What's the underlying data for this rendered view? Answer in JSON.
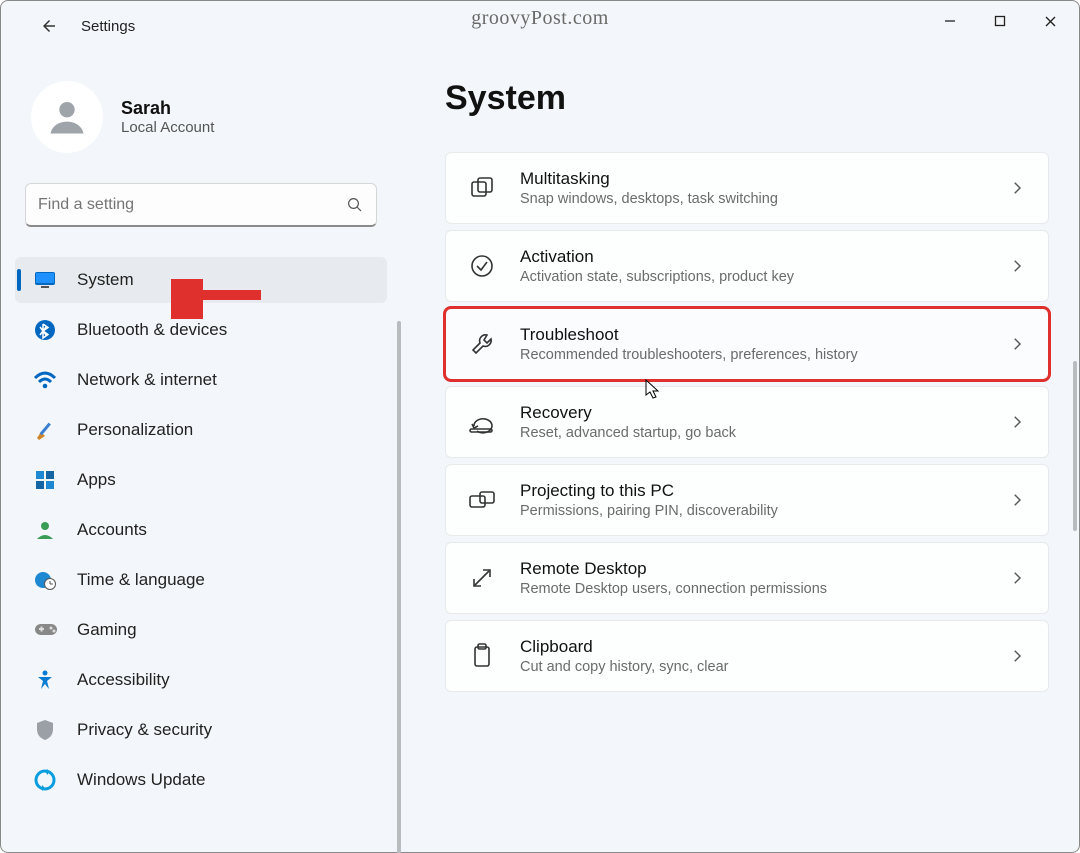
{
  "titlebar": {
    "app_title": "Settings",
    "watermark": "groovyPost.com"
  },
  "profile": {
    "name": "Sarah",
    "subtitle": "Local Account"
  },
  "search": {
    "placeholder": "Find a setting"
  },
  "sidebar": {
    "items": [
      {
        "label": "System",
        "icon": "monitor-icon",
        "selected": true
      },
      {
        "label": "Bluetooth & devices",
        "icon": "bluetooth-icon"
      },
      {
        "label": "Network & internet",
        "icon": "wifi-icon"
      },
      {
        "label": "Personalization",
        "icon": "brush-icon"
      },
      {
        "label": "Apps",
        "icon": "apps-icon"
      },
      {
        "label": "Accounts",
        "icon": "person-icon"
      },
      {
        "label": "Time & language",
        "icon": "globe-clock-icon"
      },
      {
        "label": "Gaming",
        "icon": "gamepad-icon"
      },
      {
        "label": "Accessibility",
        "icon": "accessibility-icon"
      },
      {
        "label": "Privacy & security",
        "icon": "shield-icon"
      },
      {
        "label": "Windows Update",
        "icon": "update-icon"
      }
    ]
  },
  "main": {
    "heading": "System",
    "cards": [
      {
        "title": "Multitasking",
        "subtitle": "Snap windows, desktops, task switching",
        "icon": "multitask-icon"
      },
      {
        "title": "Activation",
        "subtitle": "Activation state, subscriptions, product key",
        "icon": "check-circle-icon"
      },
      {
        "title": "Troubleshoot",
        "subtitle": "Recommended troubleshooters, preferences, history",
        "icon": "wrench-icon",
        "highlight": true
      },
      {
        "title": "Recovery",
        "subtitle": "Reset, advanced startup, go back",
        "icon": "recovery-icon"
      },
      {
        "title": "Projecting to this PC",
        "subtitle": "Permissions, pairing PIN, discoverability",
        "icon": "project-icon"
      },
      {
        "title": "Remote Desktop",
        "subtitle": "Remote Desktop users, connection permissions",
        "icon": "remote-icon"
      },
      {
        "title": "Clipboard",
        "subtitle": "Cut and copy history, sync, clear",
        "icon": "clipboard-icon"
      }
    ]
  },
  "annotations": {
    "arrow_target": "System",
    "cursor_over": "Troubleshoot"
  }
}
